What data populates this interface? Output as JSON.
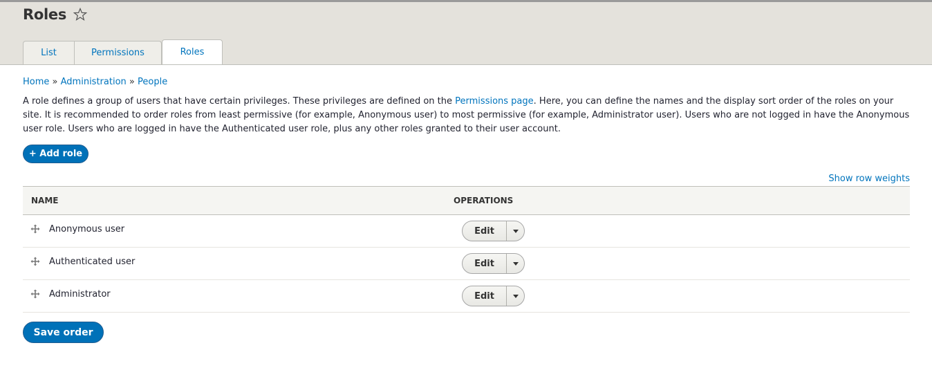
{
  "header": {
    "title": "Roles",
    "star_icon": "star-outline-icon"
  },
  "tabs": [
    {
      "label": "List",
      "active": false
    },
    {
      "label": "Permissions",
      "active": false
    },
    {
      "label": "Roles",
      "active": true
    }
  ],
  "breadcrumb": {
    "items": [
      "Home",
      "Administration",
      "People"
    ],
    "separator": "»"
  },
  "description": {
    "part1": "A role defines a group of users that have certain privileges. These privileges are defined on the ",
    "link": "Permissions page",
    "part2": ". Here, you can define the names and the display sort order of the roles on your site. It is recommended to order roles from least permissive (for example, Anonymous user) to most permissive (for example, Administrator user). Users who are not logged in have the Anonymous user role. Users who are logged in have the Authenticated user role, plus any other roles granted to their user account."
  },
  "actions": {
    "add_role": "+ Add role",
    "show_row_weights": "Show row weights",
    "save_order": "Save order"
  },
  "table": {
    "headers": [
      "NAME",
      "OPERATIONS"
    ],
    "rows": [
      {
        "name": "Anonymous user",
        "operation": "Edit"
      },
      {
        "name": "Authenticated user",
        "operation": "Edit"
      },
      {
        "name": "Administrator",
        "operation": "Edit"
      }
    ]
  },
  "colors": {
    "accent": "#0071b8",
    "link": "#0074bd",
    "header_bg": "#e4e2dc"
  }
}
